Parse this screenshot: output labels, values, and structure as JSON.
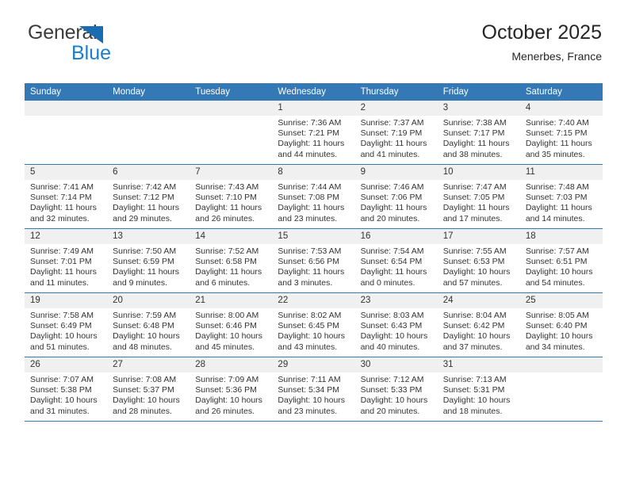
{
  "brand": {
    "name_top": "General",
    "name_bottom": "Blue",
    "accent_color": "#1a7ec8"
  },
  "header": {
    "title": "October 2025",
    "subtitle": "Menerbes, France"
  },
  "theme": {
    "header_blue": "#3479b5",
    "daynum_bg": "#f0f0f0",
    "text": "#333333"
  },
  "calendar": {
    "weekday_headers": [
      "Sunday",
      "Monday",
      "Tuesday",
      "Wednesday",
      "Thursday",
      "Friday",
      "Saturday"
    ],
    "labels": {
      "sunrise": "Sunrise:",
      "sunset": "Sunset:",
      "daylight": "Daylight:"
    },
    "weeks": [
      [
        {
          "day": "",
          "sunrise": "",
          "sunset": "",
          "daylight": ""
        },
        {
          "day": "",
          "sunrise": "",
          "sunset": "",
          "daylight": ""
        },
        {
          "day": "",
          "sunrise": "",
          "sunset": "",
          "daylight": ""
        },
        {
          "day": "1",
          "sunrise": "Sunrise: 7:36 AM",
          "sunset": "Sunset: 7:21 PM",
          "daylight": "Daylight: 11 hours and 44 minutes."
        },
        {
          "day": "2",
          "sunrise": "Sunrise: 7:37 AM",
          "sunset": "Sunset: 7:19 PM",
          "daylight": "Daylight: 11 hours and 41 minutes."
        },
        {
          "day": "3",
          "sunrise": "Sunrise: 7:38 AM",
          "sunset": "Sunset: 7:17 PM",
          "daylight": "Daylight: 11 hours and 38 minutes."
        },
        {
          "day": "4",
          "sunrise": "Sunrise: 7:40 AM",
          "sunset": "Sunset: 7:15 PM",
          "daylight": "Daylight: 11 hours and 35 minutes."
        }
      ],
      [
        {
          "day": "5",
          "sunrise": "Sunrise: 7:41 AM",
          "sunset": "Sunset: 7:14 PM",
          "daylight": "Daylight: 11 hours and 32 minutes."
        },
        {
          "day": "6",
          "sunrise": "Sunrise: 7:42 AM",
          "sunset": "Sunset: 7:12 PM",
          "daylight": "Daylight: 11 hours and 29 minutes."
        },
        {
          "day": "7",
          "sunrise": "Sunrise: 7:43 AM",
          "sunset": "Sunset: 7:10 PM",
          "daylight": "Daylight: 11 hours and 26 minutes."
        },
        {
          "day": "8",
          "sunrise": "Sunrise: 7:44 AM",
          "sunset": "Sunset: 7:08 PM",
          "daylight": "Daylight: 11 hours and 23 minutes."
        },
        {
          "day": "9",
          "sunrise": "Sunrise: 7:46 AM",
          "sunset": "Sunset: 7:06 PM",
          "daylight": "Daylight: 11 hours and 20 minutes."
        },
        {
          "day": "10",
          "sunrise": "Sunrise: 7:47 AM",
          "sunset": "Sunset: 7:05 PM",
          "daylight": "Daylight: 11 hours and 17 minutes."
        },
        {
          "day": "11",
          "sunrise": "Sunrise: 7:48 AM",
          "sunset": "Sunset: 7:03 PM",
          "daylight": "Daylight: 11 hours and 14 minutes."
        }
      ],
      [
        {
          "day": "12",
          "sunrise": "Sunrise: 7:49 AM",
          "sunset": "Sunset: 7:01 PM",
          "daylight": "Daylight: 11 hours and 11 minutes."
        },
        {
          "day": "13",
          "sunrise": "Sunrise: 7:50 AM",
          "sunset": "Sunset: 6:59 PM",
          "daylight": "Daylight: 11 hours and 9 minutes."
        },
        {
          "day": "14",
          "sunrise": "Sunrise: 7:52 AM",
          "sunset": "Sunset: 6:58 PM",
          "daylight": "Daylight: 11 hours and 6 minutes."
        },
        {
          "day": "15",
          "sunrise": "Sunrise: 7:53 AM",
          "sunset": "Sunset: 6:56 PM",
          "daylight": "Daylight: 11 hours and 3 minutes."
        },
        {
          "day": "16",
          "sunrise": "Sunrise: 7:54 AM",
          "sunset": "Sunset: 6:54 PM",
          "daylight": "Daylight: 11 hours and 0 minutes."
        },
        {
          "day": "17",
          "sunrise": "Sunrise: 7:55 AM",
          "sunset": "Sunset: 6:53 PM",
          "daylight": "Daylight: 10 hours and 57 minutes."
        },
        {
          "day": "18",
          "sunrise": "Sunrise: 7:57 AM",
          "sunset": "Sunset: 6:51 PM",
          "daylight": "Daylight: 10 hours and 54 minutes."
        }
      ],
      [
        {
          "day": "19",
          "sunrise": "Sunrise: 7:58 AM",
          "sunset": "Sunset: 6:49 PM",
          "daylight": "Daylight: 10 hours and 51 minutes."
        },
        {
          "day": "20",
          "sunrise": "Sunrise: 7:59 AM",
          "sunset": "Sunset: 6:48 PM",
          "daylight": "Daylight: 10 hours and 48 minutes."
        },
        {
          "day": "21",
          "sunrise": "Sunrise: 8:00 AM",
          "sunset": "Sunset: 6:46 PM",
          "daylight": "Daylight: 10 hours and 45 minutes."
        },
        {
          "day": "22",
          "sunrise": "Sunrise: 8:02 AM",
          "sunset": "Sunset: 6:45 PM",
          "daylight": "Daylight: 10 hours and 43 minutes."
        },
        {
          "day": "23",
          "sunrise": "Sunrise: 8:03 AM",
          "sunset": "Sunset: 6:43 PM",
          "daylight": "Daylight: 10 hours and 40 minutes."
        },
        {
          "day": "24",
          "sunrise": "Sunrise: 8:04 AM",
          "sunset": "Sunset: 6:42 PM",
          "daylight": "Daylight: 10 hours and 37 minutes."
        },
        {
          "day": "25",
          "sunrise": "Sunrise: 8:05 AM",
          "sunset": "Sunset: 6:40 PM",
          "daylight": "Daylight: 10 hours and 34 minutes."
        }
      ],
      [
        {
          "day": "26",
          "sunrise": "Sunrise: 7:07 AM",
          "sunset": "Sunset: 5:38 PM",
          "daylight": "Daylight: 10 hours and 31 minutes."
        },
        {
          "day": "27",
          "sunrise": "Sunrise: 7:08 AM",
          "sunset": "Sunset: 5:37 PM",
          "daylight": "Daylight: 10 hours and 28 minutes."
        },
        {
          "day": "28",
          "sunrise": "Sunrise: 7:09 AM",
          "sunset": "Sunset: 5:36 PM",
          "daylight": "Daylight: 10 hours and 26 minutes."
        },
        {
          "day": "29",
          "sunrise": "Sunrise: 7:11 AM",
          "sunset": "Sunset: 5:34 PM",
          "daylight": "Daylight: 10 hours and 23 minutes."
        },
        {
          "day": "30",
          "sunrise": "Sunrise: 7:12 AM",
          "sunset": "Sunset: 5:33 PM",
          "daylight": "Daylight: 10 hours and 20 minutes."
        },
        {
          "day": "31",
          "sunrise": "Sunrise: 7:13 AM",
          "sunset": "Sunset: 5:31 PM",
          "daylight": "Daylight: 10 hours and 18 minutes."
        },
        {
          "day": "",
          "sunrise": "",
          "sunset": "",
          "daylight": ""
        }
      ]
    ]
  }
}
